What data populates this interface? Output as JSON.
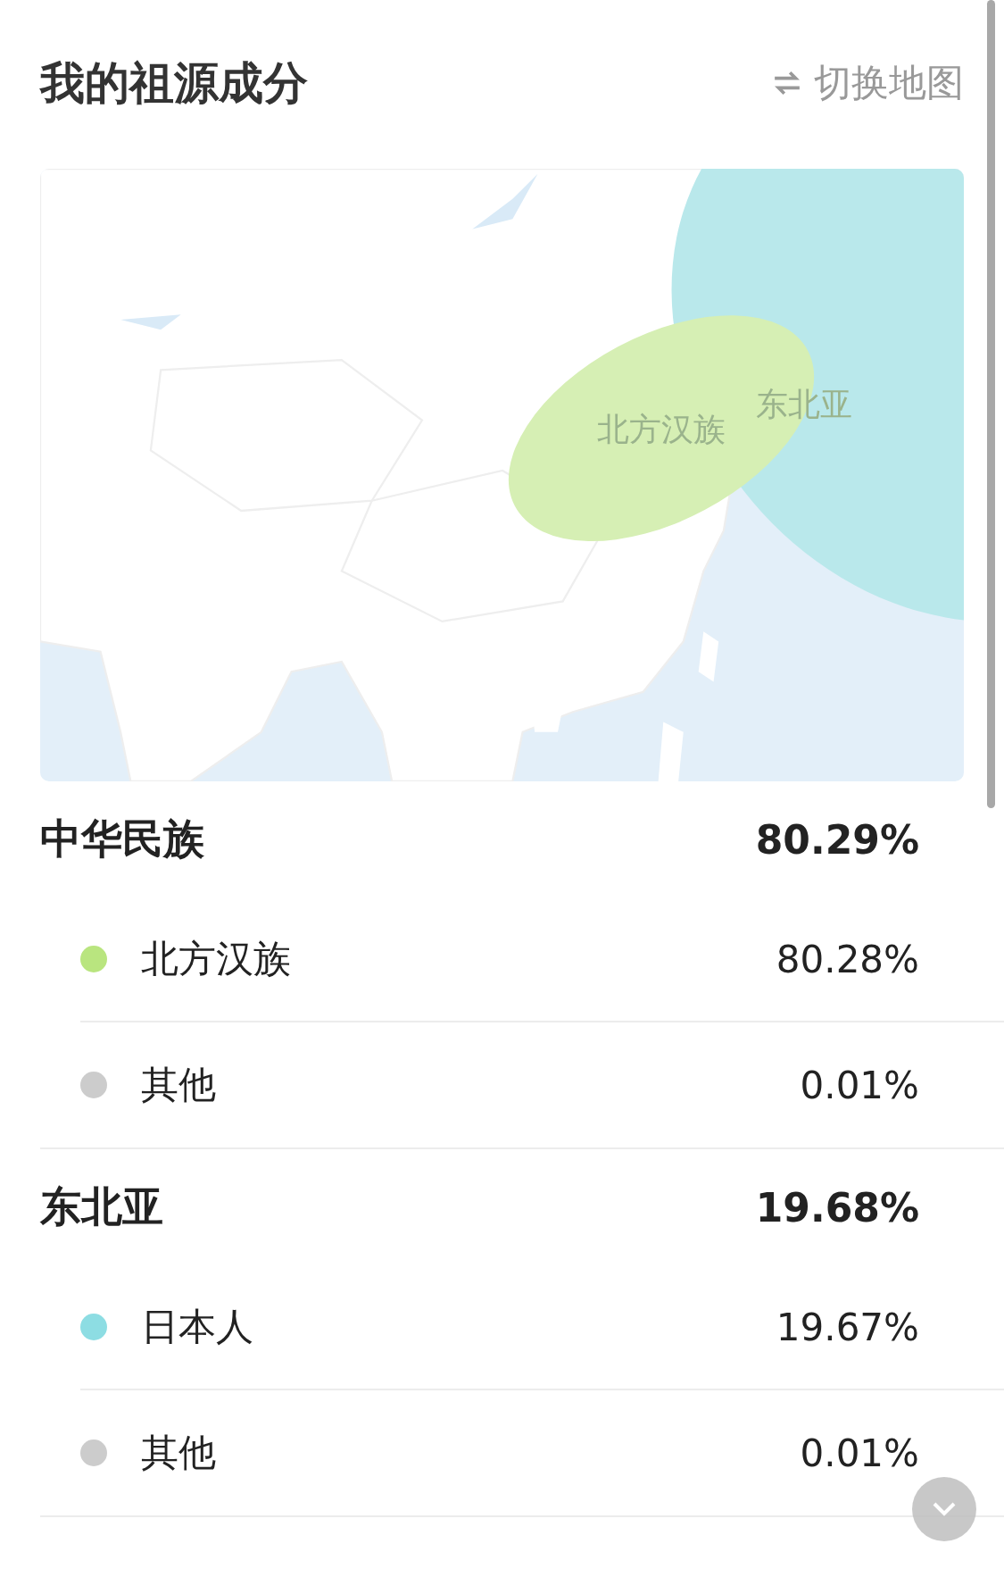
{
  "header": {
    "title": "我的祖源成分",
    "switch_link": "切换地图"
  },
  "map": {
    "regions": [
      {
        "label": "北方汉族",
        "color": "#d6efb4"
      },
      {
        "label": "东北亚",
        "color": "#b9e8eb"
      }
    ]
  },
  "groups": [
    {
      "name": "中华民族",
      "percent": "80.29%",
      "items": [
        {
          "name": "北方汉族",
          "percent": "80.28%",
          "color": "#b9e57f"
        },
        {
          "name": "其他",
          "percent": "0.01%",
          "color": "#cccccc"
        }
      ]
    },
    {
      "name": "东北亚",
      "percent": "19.68%",
      "items": [
        {
          "name": "日本人",
          "percent": "19.67%",
          "color": "#8ddde3"
        },
        {
          "name": "其他",
          "percent": "0.01%",
          "color": "#cccccc"
        }
      ]
    }
  ]
}
